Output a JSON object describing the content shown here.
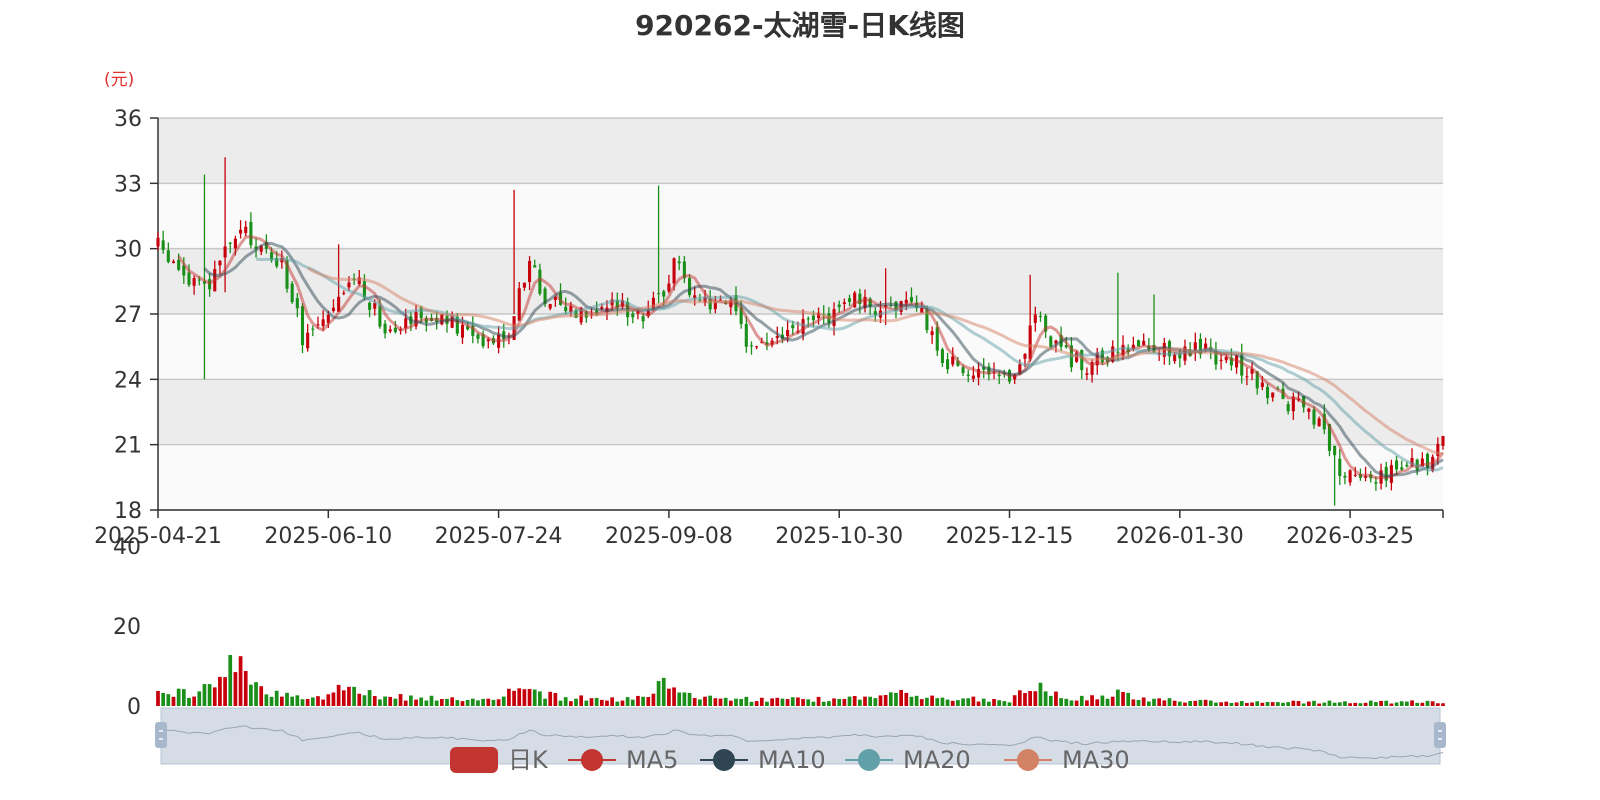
{
  "chart_data": {
    "type": "candlestick",
    "title": "920262-太湖雪-日K线图",
    "unit": "(元)",
    "price_axis": {
      "min": 18,
      "max": 36,
      "ticks": [
        18,
        21,
        24,
        27,
        30,
        33,
        36
      ]
    },
    "volume_axis": {
      "min": 0,
      "max": 40,
      "ticks": [
        0,
        20,
        40
      ]
    },
    "x_tick_labels": [
      "2025-04-21",
      "2025-06-10",
      "2025-07-24",
      "2025-09-08",
      "2025-10-30",
      "2025-12-15",
      "2026-01-30",
      "2026-03-25"
    ],
    "x_tick_index": [
      0,
      33,
      66,
      99,
      132,
      165,
      198,
      231
    ],
    "days_count": 250,
    "price_anchors": [
      [
        0,
        30.1
      ],
      [
        6,
        28.5
      ],
      [
        10,
        28.2
      ],
      [
        12,
        29.5
      ],
      [
        16,
        30.8
      ],
      [
        20,
        30.0
      ],
      [
        24,
        29.3
      ],
      [
        28,
        26.0
      ],
      [
        34,
        26.9
      ],
      [
        36,
        28.0
      ],
      [
        38,
        28.8
      ],
      [
        42,
        27.2
      ],
      [
        44,
        26.4
      ],
      [
        50,
        27.0
      ],
      [
        56,
        26.6
      ],
      [
        60,
        26.1
      ],
      [
        64,
        25.9
      ],
      [
        68,
        26.2
      ],
      [
        70,
        28.0
      ],
      [
        72,
        29.5
      ],
      [
        74,
        28.0
      ],
      [
        80,
        27.2
      ],
      [
        86,
        27.3
      ],
      [
        90,
        27.4
      ],
      [
        94,
        27.0
      ],
      [
        98,
        27.8
      ],
      [
        100,
        29.8
      ],
      [
        102,
        28.5
      ],
      [
        106,
        27.5
      ],
      [
        110,
        27.8
      ],
      [
        114,
        25.6
      ],
      [
        118,
        25.7
      ],
      [
        122,
        26.0
      ],
      [
        126,
        26.6
      ],
      [
        130,
        27.0
      ],
      [
        134,
        27.8
      ],
      [
        138,
        27.2
      ],
      [
        140,
        27.5
      ],
      [
        144,
        27.3
      ],
      [
        148,
        27.0
      ],
      [
        150,
        26.2
      ],
      [
        152,
        24.8
      ],
      [
        156,
        24.6
      ],
      [
        160,
        24.0
      ],
      [
        164,
        23.8
      ],
      [
        166,
        24.3
      ],
      [
        168,
        25.5
      ],
      [
        170,
        27.2
      ],
      [
        172,
        26.2
      ],
      [
        176,
        25.1
      ],
      [
        180,
        24.6
      ],
      [
        186,
        25.2
      ],
      [
        190,
        25.6
      ],
      [
        194,
        25.5
      ],
      [
        198,
        25.3
      ],
      [
        202,
        25.4
      ],
      [
        206,
        25.0
      ],
      [
        210,
        24.6
      ],
      [
        214,
        23.6
      ],
      [
        218,
        23.1
      ],
      [
        222,
        22.6
      ],
      [
        225,
        21.8
      ],
      [
        227,
        20.8
      ],
      [
        229,
        19.8
      ],
      [
        232,
        19.4
      ],
      [
        236,
        19.6
      ],
      [
        240,
        19.9
      ],
      [
        244,
        20.2
      ],
      [
        246,
        20.3
      ],
      [
        249,
        21.1
      ]
    ],
    "spikes": [
      {
        "day": 9,
        "high": 33.4,
        "low": 24.0
      },
      {
        "day": 13,
        "high": 34.2,
        "low": 28.0
      },
      {
        "day": 35,
        "high": 30.2,
        "low": 27.5
      },
      {
        "day": 69,
        "high": 32.7,
        "low": 27.0
      },
      {
        "day": 97,
        "high": 32.9,
        "low": 27.5
      },
      {
        "day": 141,
        "high": 29.1,
        "low": 26.5
      },
      {
        "day": 169,
        "high": 28.8,
        "low": 24.8
      },
      {
        "day": 186,
        "high": 28.9,
        "low": 24.9
      },
      {
        "day": 193,
        "high": 27.9,
        "low": 25.2
      },
      {
        "day": 228,
        "high": 20.9,
        "low": 18.2
      }
    ],
    "volume_anchors": [
      [
        0,
        3.5
      ],
      [
        6,
        3.0
      ],
      [
        10,
        5.0
      ],
      [
        12,
        9.0
      ],
      [
        14,
        12.0
      ],
      [
        16,
        10.0
      ],
      [
        18,
        6.0
      ],
      [
        22,
        3.0
      ],
      [
        30,
        2.0
      ],
      [
        34,
        3.0
      ],
      [
        36,
        5.0
      ],
      [
        40,
        3.0
      ],
      [
        50,
        2.0
      ],
      [
        60,
        1.5
      ],
      [
        66,
        1.5
      ],
      [
        68,
        4.0
      ],
      [
        70,
        6.0
      ],
      [
        72,
        4.0
      ],
      [
        78,
        2.0
      ],
      [
        90,
        1.8
      ],
      [
        96,
        3.0
      ],
      [
        97,
        7.0
      ],
      [
        99,
        4.0
      ],
      [
        104,
        2.0
      ],
      [
        120,
        1.5
      ],
      [
        140,
        2.0
      ],
      [
        144,
        3.5
      ],
      [
        148,
        2.0
      ],
      [
        165,
        1.5
      ],
      [
        168,
        4.0
      ],
      [
        170,
        6.0
      ],
      [
        172,
        3.0
      ],
      [
        180,
        1.8
      ],
      [
        186,
        3.0
      ],
      [
        190,
        2.0
      ],
      [
        200,
        1.2
      ],
      [
        220,
        1.0
      ],
      [
        249,
        1.0
      ]
    ],
    "ma_periods": [
      5,
      10,
      20,
      30
    ],
    "colors": {
      "up": "#c7000b",
      "down": "#1a8f1a",
      "ma5": "#c23531",
      "ma10": "#2f4554",
      "ma20": "#61a0a8",
      "ma30": "#d48265"
    }
  },
  "legend": [
    {
      "label": "日K",
      "color": "#c23531",
      "kind": "candle"
    },
    {
      "label": "MA5",
      "color": "#c23531",
      "kind": "line"
    },
    {
      "label": "MA10",
      "color": "#2f4554",
      "kind": "line"
    },
    {
      "label": "MA20",
      "color": "#61a0a8",
      "kind": "line"
    },
    {
      "label": "MA30",
      "color": "#d48265",
      "kind": "line"
    }
  ]
}
